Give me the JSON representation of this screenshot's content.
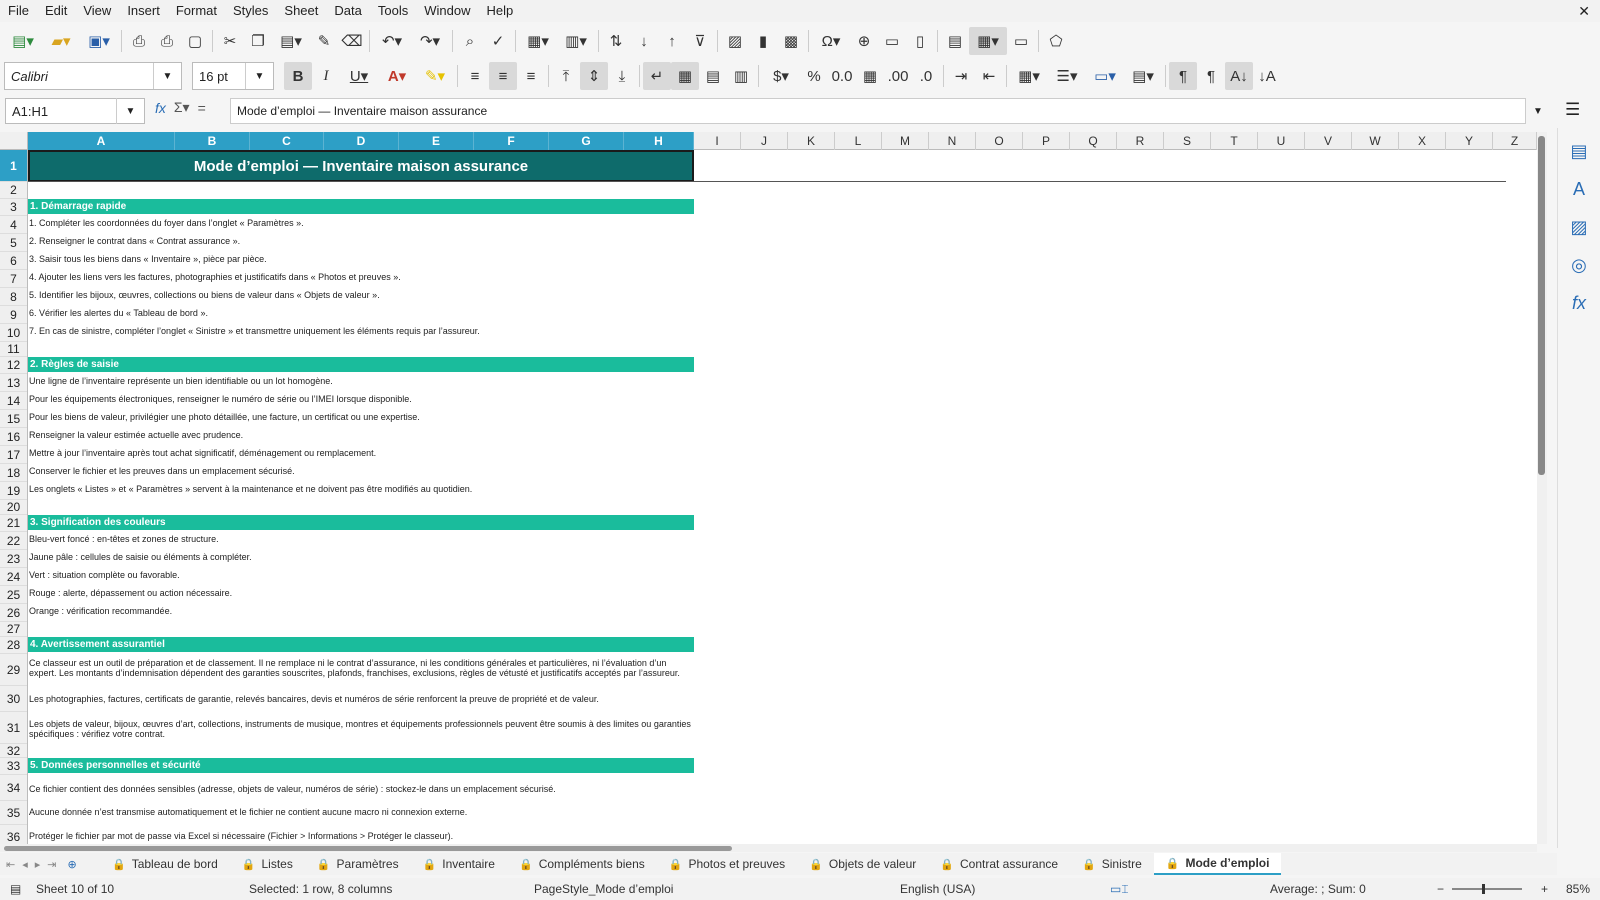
{
  "menu": [
    "File",
    "Edit",
    "View",
    "Insert",
    "Format",
    "Styles",
    "Sheet",
    "Data",
    "Tools",
    "Window",
    "Help"
  ],
  "close_glyph": "✕",
  "font_name": "Calibri",
  "font_size": "16 pt",
  "name_box": "A1:H1",
  "formula": "Mode d’emploi — Inventaire maison assurance",
  "columns": [
    "A",
    "B",
    "C",
    "D",
    "E",
    "F",
    "G",
    "H",
    "I",
    "J",
    "K",
    "L",
    "M",
    "N",
    "O",
    "P",
    "Q",
    "R",
    "S",
    "T",
    "U",
    "V",
    "W",
    "X",
    "Y",
    "Z"
  ],
  "rows": [
    "1",
    "2",
    "3",
    "4",
    "5",
    "6",
    "7",
    "8",
    "9",
    "10",
    "11",
    "12",
    "13",
    "14",
    "15",
    "16",
    "17",
    "18",
    "19",
    "20",
    "21",
    "22",
    "23",
    "24",
    "25",
    "26",
    "27",
    "28",
    "29",
    "30",
    "31",
    "32",
    "33",
    "34",
    "35",
    "36"
  ],
  "sheet_title": "Mode d’emploi — Inventaire maison assurance",
  "sections": {
    "s1": "1. Démarrage rapide",
    "s2": "2. Règles de saisie",
    "s3": "3. Signification des couleurs",
    "s4": "4. Avertissement assurantiel",
    "s5": "5. Données personnelles et sécurité"
  },
  "lines": {
    "r4": "1. Compléter les coordonnées du foyer dans l’onglet « Paramètres ».",
    "r5": "2. Renseigner le contrat dans « Contrat assurance ».",
    "r6": "3. Saisir tous les biens dans « Inventaire », pièce par pièce.",
    "r7": "4. Ajouter les liens vers les factures, photographies et justificatifs dans « Photos et preuves ».",
    "r8": "5. Identifier les bijoux, œuvres, collections ou biens de valeur dans « Objets de valeur ».",
    "r9": "6. Vérifier les alertes du « Tableau de bord ».",
    "r10": "7. En cas de sinistre, compléter l’onglet « Sinistre » et transmettre uniquement les éléments requis par l’assureur.",
    "r13": "Une ligne de l’inventaire représente un bien identifiable ou un lot homogène.",
    "r14": "Pour les équipements électroniques, renseigner le numéro de série ou l’IMEI lorsque disponible.",
    "r15": "Pour les biens de valeur, privilégier une photo détaillée, une facture, un certificat ou une expertise.",
    "r16": "Renseigner la valeur estimée actuelle avec prudence.",
    "r17": "Mettre à jour l’inventaire après tout achat significatif, déménagement ou remplacement.",
    "r18": "Conserver le fichier et les preuves dans un emplacement sécurisé.",
    "r19": "Les onglets « Listes » et « Paramètres » servent à la maintenance et ne doivent pas être modifiés au quotidien.",
    "r22": "Bleu-vert foncé : en-têtes et zones de structure.",
    "r23": "Jaune pâle : cellules de saisie ou éléments à compléter.",
    "r24": "Vert : situation complète ou favorable.",
    "r25": "Rouge : alerte, dépassement ou action nécessaire.",
    "r26": "Orange : vérification recommandée.",
    "r29": "Ce classeur est un outil de préparation et de classement. Il ne remplace ni le contrat d’assurance, ni les conditions générales et particulières, ni l’évaluation d’un expert. Les montants d’indemnisation dépendent des garanties souscrites, plafonds, franchises, exclusions, règles de vétusté et justificatifs acceptés par l’assureur.",
    "r30": "Les photographies, factures, certificats de garantie, relevés bancaires, devis et numéros de série renforcent la preuve de propriété et de valeur.",
    "r31": "Les objets de valeur, bijoux, œuvres d’art, collections, instruments de musique, montres et équipements professionnels peuvent être soumis à des limites ou garanties spécifiques : vérifiez votre contrat.",
    "r34": "Ce fichier contient des données sensibles (adresse, objets de valeur, numéros de série) : stockez-le dans un emplacement sécurisé.",
    "r35": "Aucune donnée n’est transmise automatiquement et le fichier ne contient aucune macro ni connexion externe.",
    "r36": "Protéger le fichier par mot de passe via Excel si nécessaire (Fichier > Informations > Protéger le classeur)."
  },
  "tabs": [
    "Tableau de bord",
    "Listes",
    "Paramètres",
    "Inventaire",
    "Compléments biens",
    "Photos et preuves",
    "Objets de valeur",
    "Contrat assurance",
    "Sinistre",
    "Mode d’emploi"
  ],
  "active_tab": "Mode d’emploi",
  "status": {
    "sheet": "Sheet 10 of 10",
    "selection": "Selected: 1 row, 8 columns",
    "pagestyle": "PageStyle_Mode d’emploi",
    "language": "English (USA)",
    "summary": "Average: ; Sum: 0",
    "zoom": "85%"
  },
  "colors": {
    "title_bg": "#0e6b6b",
    "section_bg": "#1abc9c",
    "selection": "#2d9fc6"
  }
}
